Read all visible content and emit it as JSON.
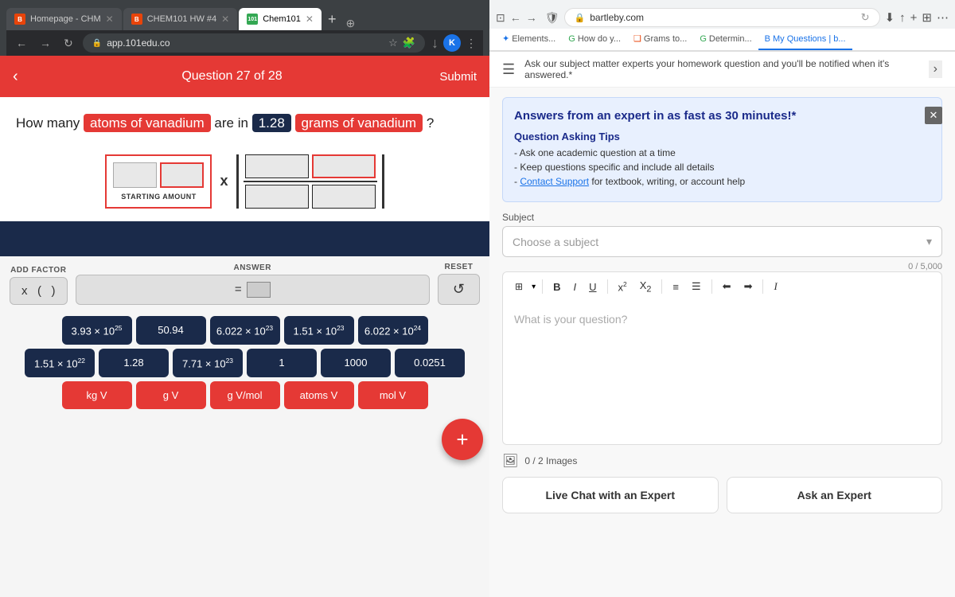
{
  "left": {
    "browser": {
      "tabs": [
        {
          "id": "homepage",
          "label": "Homepage - CHM",
          "favicon_type": "orange",
          "favicon_text": "B",
          "active": false
        },
        {
          "id": "chem101-hw",
          "label": "CHEM101 HW #4",
          "favicon_type": "orange",
          "favicon_text": "B",
          "active": false
        },
        {
          "id": "chem101",
          "label": "Chem101",
          "favicon_type": "green",
          "favicon_text": "101",
          "active": true
        }
      ],
      "url": "app.101edu.co"
    },
    "header": {
      "question": "Question 27 of 28",
      "submit": "Submit"
    },
    "question_text": {
      "prefix": "How many",
      "highlight1": "atoms of vanadium",
      "middle": "are in",
      "highlight2": "1.28",
      "highlight3": "grams of vanadium",
      "suffix": "?"
    },
    "starting_label": "STARTING AMOUNT",
    "controls": {
      "add_factor_label": "ADD FACTOR",
      "answer_label": "ANSWER",
      "reset_label": "RESET"
    },
    "numbers": [
      [
        "3.93 × 10²⁵",
        "50.94",
        "6.022 × 10²³",
        "1.51 × 10²³",
        "6.022 × 10²⁴"
      ],
      [
        "1.51 × 10²²",
        "1.28",
        "7.71 × 10²³",
        "1",
        "1000",
        "0.0251"
      ],
      [
        "kg V",
        "g V",
        "g V/mol",
        "atoms V",
        "mol V"
      ]
    ]
  },
  "right": {
    "browser": {
      "tabs": [
        {
          "label": "Elements...",
          "active": false,
          "color": "#1a73e8"
        },
        {
          "label": "How do y...",
          "active": false,
          "color": "#34a853"
        },
        {
          "label": "Grams to...",
          "active": false,
          "color": "#e8440a"
        },
        {
          "label": "Determin...",
          "active": false,
          "color": "#34a853"
        },
        {
          "label": "My Questions | b...",
          "active": true,
          "color": "#1a73e8"
        }
      ],
      "url": "bartleby.com"
    },
    "top_bar_text": "Ask our subject matter experts your homework question and you'll be notified when it's answered.*",
    "answer_section": {
      "title": "Answers from an expert in as fast as 30 minutes!*",
      "tips_title": "Question Asking Tips",
      "tip1": "- Ask one academic question at a time",
      "tip2": "- Keep questions specific and include all details",
      "tip3_prefix": "- ",
      "tip3_link": "Contact Support",
      "tip3_suffix": " for textbook, writing, or account help"
    },
    "subject": {
      "label": "Subject",
      "placeholder": "Choose a subject"
    },
    "char_count": "0 / 5,000",
    "editor": {
      "placeholder": "What is your question?"
    },
    "image_upload": {
      "label": "0 / 2 Images"
    },
    "buttons": {
      "live_chat": "Live Chat with an Expert",
      "ask_expert": "Ask an Expert"
    }
  }
}
